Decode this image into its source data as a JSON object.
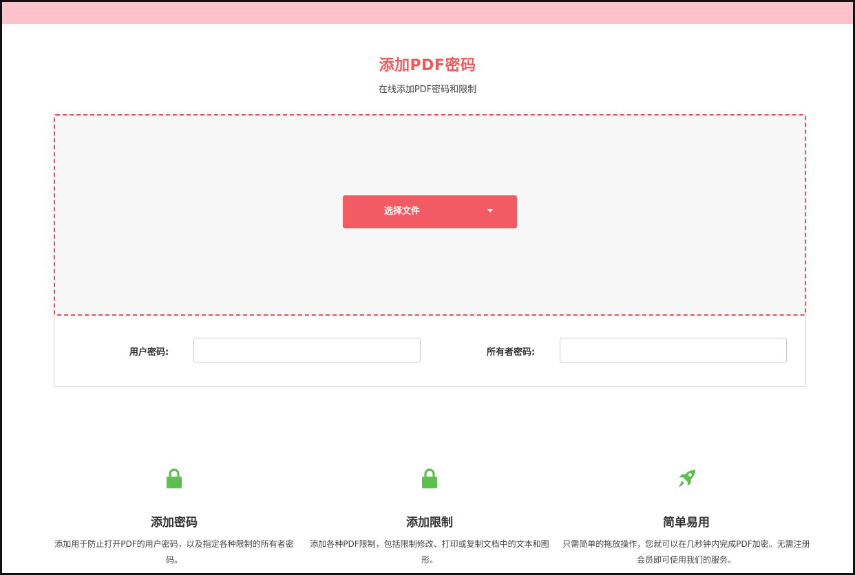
{
  "header": {
    "title": "添加PDF密码",
    "subtitle": "在线添加PDF密码和限制"
  },
  "upload": {
    "button_label": "选择文件"
  },
  "form": {
    "user_password_label": "用户密码:",
    "owner_password_label": "所有者密码:",
    "user_password_value": "",
    "owner_password_value": ""
  },
  "features": [
    {
      "icon": "lock-icon",
      "title": "添加密码",
      "text": "添加用于防止打开PDF的用户密码，以及指定各种限制的所有者密码。"
    },
    {
      "icon": "lock-icon",
      "title": "添加限制",
      "text": "添加各种PDF限制，包括限制修改、打印或复制文档中的文本和图形。"
    },
    {
      "icon": "rocket-icon",
      "title": "简单易用",
      "text": "只需简单的拖放操作，您就可以在几秒钟内完成PDF加密。无需注册会员即可使用我们的服务。"
    }
  ],
  "colors": {
    "accent": "#f25a64",
    "title": "#ee5a5a",
    "topbar": "#ffc1cc",
    "icon_green": "#5cbf4f"
  }
}
